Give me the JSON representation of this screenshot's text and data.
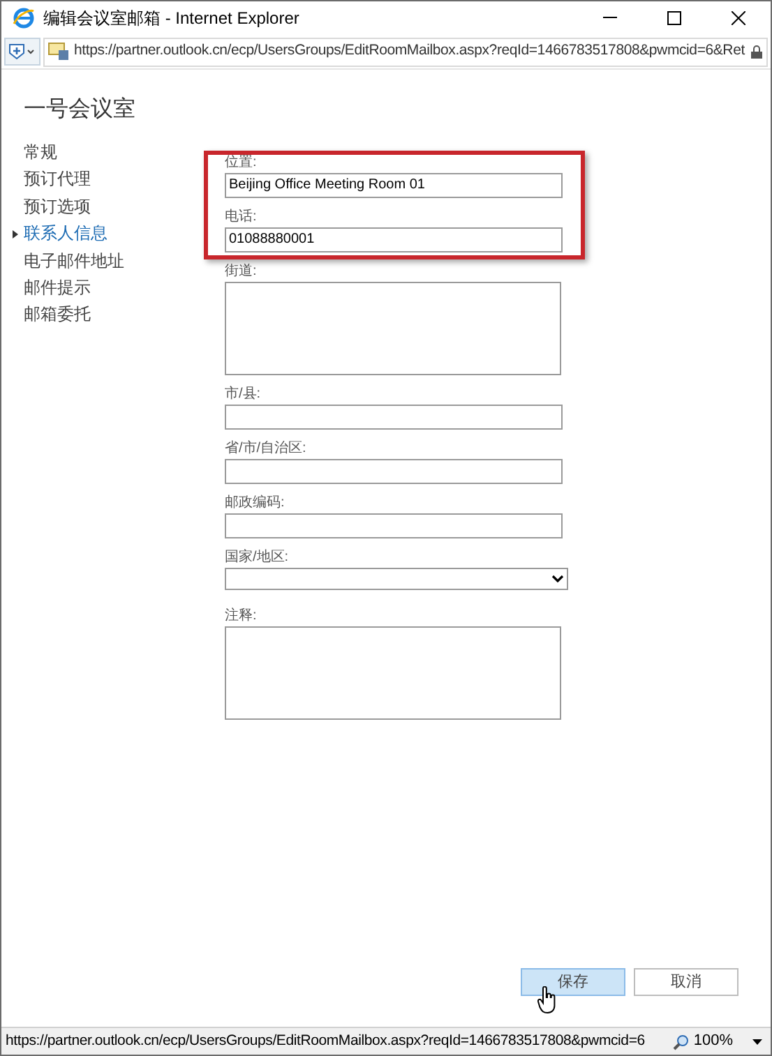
{
  "window": {
    "title": "编辑会议室邮箱 - Internet Explorer"
  },
  "address_bar": {
    "url": "https://partner.outlook.cn/ecp/UsersGroups/EditRoomMailbox.aspx?reqId=1466783517808&pwmcid=6&Ret"
  },
  "page_title": "一号会议室",
  "nav": [
    {
      "label": "常规",
      "selected": false
    },
    {
      "label": "预订代理",
      "selected": false
    },
    {
      "label": "预订选项",
      "selected": false
    },
    {
      "label": "联系人信息",
      "selected": true
    },
    {
      "label": "电子邮件地址",
      "selected": false
    },
    {
      "label": "邮件提示",
      "selected": false
    },
    {
      "label": "邮箱委托",
      "selected": false
    }
  ],
  "fields": [
    {
      "kind": "input",
      "label": "位置:",
      "value": "Beijing Office Meeting Room 01"
    },
    {
      "kind": "input",
      "label": "电话:",
      "value": "01088880001"
    },
    {
      "kind": "textarea",
      "label": "街道:"
    },
    {
      "kind": "input",
      "label": "市/县:"
    },
    {
      "kind": "input",
      "label": "省/市/自治区:"
    },
    {
      "kind": "input",
      "label": "邮政编码:"
    },
    {
      "kind": "select",
      "label": "国家/地区:"
    },
    {
      "kind": "textarea",
      "label": "注释:"
    }
  ],
  "buttons": [
    {
      "label": "保存",
      "kind": "primary"
    },
    {
      "label": "取消",
      "kind": "secondary"
    }
  ],
  "status_bar": {
    "url": "https://partner.outlook.cn/ecp/UsersGroups/EditRoomMailbox.aspx?reqId=1466783517808&pwmcid=6",
    "zoom": "100%"
  }
}
